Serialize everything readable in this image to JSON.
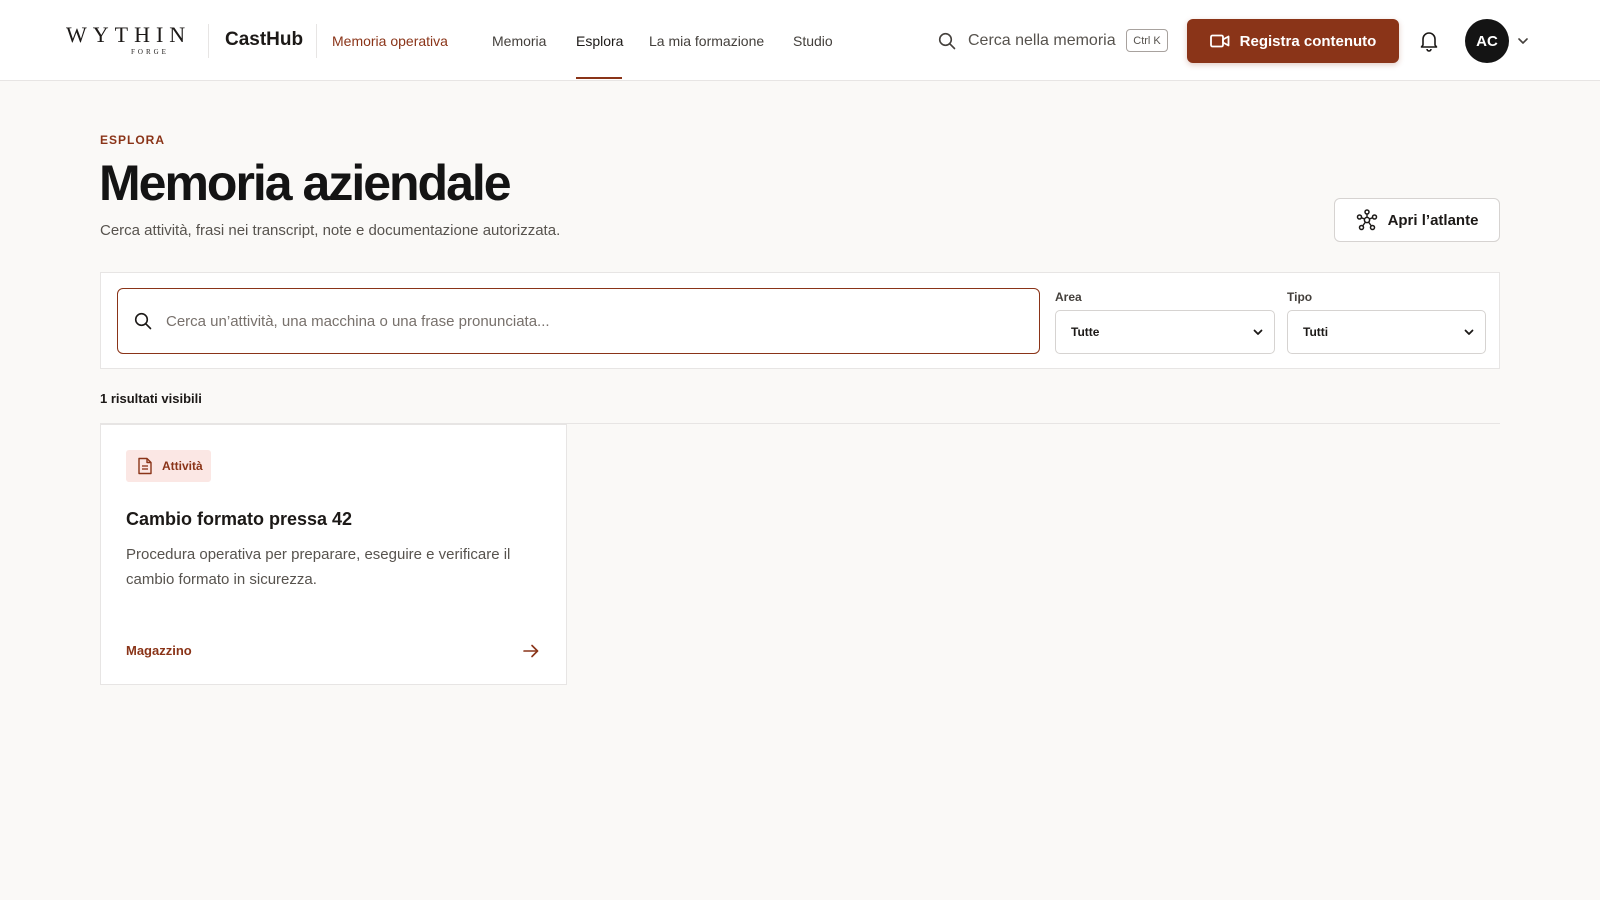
{
  "brand": {
    "logo_text": "WYTHIN",
    "logo_subtext": "FORGE",
    "product_name": "CastHub",
    "product_tag": "Memoria operativa"
  },
  "nav": {
    "items": [
      {
        "label": "Memoria",
        "active": false
      },
      {
        "label": "Esplora",
        "active": true
      },
      {
        "label": "La mia formazione",
        "active": false
      },
      {
        "label": "Studio",
        "active": false
      }
    ]
  },
  "topbar": {
    "search_label": "Cerca nella memoria",
    "search_shortcut": "Ctrl K",
    "record_button": "Registra contenuto",
    "avatar_initials": "AC"
  },
  "header": {
    "eyebrow": "ESPLORA",
    "title": "Memoria aziendale",
    "subtitle": "Cerca attività, frasi nei transcript, note e documentazione autorizzata.",
    "atlas_button": "Apri l’atlante"
  },
  "filters": {
    "search_placeholder": "Cerca un’attività, una macchina o una frase pronunciata...",
    "search_value": "",
    "area_label": "Area",
    "area_value": "Tutte",
    "type_label": "Tipo",
    "type_value": "Tutti"
  },
  "results": {
    "count_text": "1 risultati visibili",
    "items": [
      {
        "type": "Attività",
        "title": "Cambio formato pressa 42",
        "description": "Procedura operativa per preparare, eseguire e verificare il cambio formato in sicurezza.",
        "area": "Magazzino"
      }
    ]
  },
  "colors": {
    "accent": "#8a3418",
    "page_bg": "#faf9f7",
    "badge_bg": "#fbe7e4",
    "avatar_bg": "#141414"
  }
}
